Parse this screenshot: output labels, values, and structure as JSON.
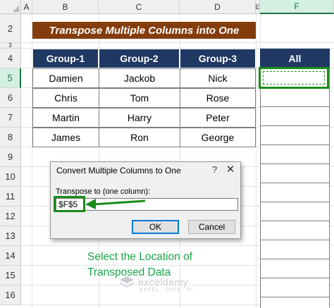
{
  "columns": [
    "A",
    "B",
    "C",
    "D",
    "E",
    "F"
  ],
  "selected_column": "F",
  "rows": [
    "2",
    "3",
    "4",
    "5",
    "6",
    "7",
    "8",
    "9",
    "10",
    "11",
    "12",
    "13",
    "14",
    "15",
    "16"
  ],
  "selected_row": "5",
  "title": "Transpose Multiple Columns into One",
  "table": {
    "headers": [
      "Group-1",
      "Group-2",
      "Group-3"
    ],
    "rows": [
      [
        "Damien",
        "Jackob",
        "Nick"
      ],
      [
        "Chris",
        "Tom",
        "Rose"
      ],
      [
        "Martin",
        "Harry",
        "Peter"
      ],
      [
        "James",
        "Ron",
        "George"
      ]
    ]
  },
  "all_column": {
    "header": "All"
  },
  "dialog": {
    "title": "Convert Multiple Columns to One",
    "help": "?",
    "close": "✕",
    "label": "Transpose to (one column):",
    "input_value": "$F$5",
    "ok_label": "OK",
    "cancel_label": "Cancel"
  },
  "annotation": {
    "line1": "Select the Location of",
    "line2": "Transposed Data"
  },
  "watermark": {
    "name": "exceldemy",
    "tagline": "EXCEL · DATA · BI"
  },
  "colors": {
    "title_bg": "#843c0c",
    "header_bg": "#1f3864",
    "highlight": "#1a8c1a",
    "annotation": "#1aa64a"
  }
}
